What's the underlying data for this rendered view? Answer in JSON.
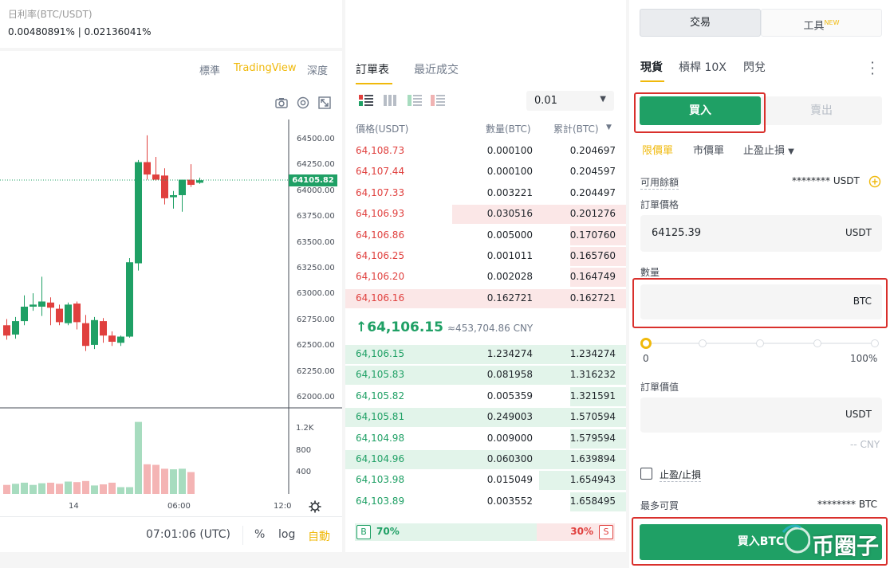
{
  "header": {
    "rate_label": "日利率(BTC/USDT)",
    "rate_value": "0.00480891% | 0.02136041%"
  },
  "chart": {
    "tabs": [
      {
        "label": "標準"
      },
      {
        "label": "TradingView"
      },
      {
        "label": "深度"
      }
    ],
    "active_tab": "TradingView",
    "price_ticks": [
      "64500.00",
      "64250.00",
      "64000.00",
      "63750.00",
      "63500.00",
      "63250.00",
      "63000.00",
      "62750.00",
      "62500.00",
      "62250.00",
      "62000.00"
    ],
    "current_price_tag": "64105.82",
    "volume_ticks": [
      "1.2K",
      "800",
      "400"
    ],
    "time_ticks": [
      "14",
      "06:00",
      "12:0"
    ],
    "clock": "07:01:06 (UTC)",
    "pct": "%",
    "log": "log",
    "auto": "自動"
  },
  "chart_data": {
    "type": "candlestick",
    "ylim": [
      62000,
      64600
    ],
    "candles": [
      {
        "o": 62700,
        "h": 62760,
        "l": 62560,
        "c": 62600
      },
      {
        "o": 62610,
        "h": 62780,
        "l": 62570,
        "c": 62740
      },
      {
        "o": 62740,
        "h": 62990,
        "l": 62700,
        "c": 62880
      },
      {
        "o": 62880,
        "h": 63010,
        "l": 62840,
        "c": 62900
      },
      {
        "o": 62880,
        "h": 63170,
        "l": 62790,
        "c": 62930
      },
      {
        "o": 62920,
        "h": 62970,
        "l": 62700,
        "c": 62870
      },
      {
        "o": 62860,
        "h": 62900,
        "l": 62700,
        "c": 62730
      },
      {
        "o": 62720,
        "h": 62920,
        "l": 62700,
        "c": 62900
      },
      {
        "o": 62910,
        "h": 62930,
        "l": 62660,
        "c": 62730
      },
      {
        "o": 62720,
        "h": 62800,
        "l": 62450,
        "c": 62500
      },
      {
        "o": 62510,
        "h": 62780,
        "l": 62470,
        "c": 62750
      },
      {
        "o": 62740,
        "h": 62770,
        "l": 62530,
        "c": 62600
      },
      {
        "o": 62600,
        "h": 62640,
        "l": 62500,
        "c": 62540
      },
      {
        "o": 62530,
        "h": 62600,
        "l": 62500,
        "c": 62590
      },
      {
        "o": 62590,
        "h": 63350,
        "l": 62580,
        "c": 63310
      },
      {
        "o": 63300,
        "h": 64300,
        "l": 63230,
        "c": 64280
      },
      {
        "o": 64280,
        "h": 64540,
        "l": 64110,
        "c": 64160
      },
      {
        "o": 64160,
        "h": 64330,
        "l": 64100,
        "c": 64110
      },
      {
        "o": 64150,
        "h": 64220,
        "l": 63870,
        "c": 63930
      },
      {
        "o": 63940,
        "h": 64000,
        "l": 63830,
        "c": 63960
      },
      {
        "o": 63960,
        "h": 64080,
        "l": 63800,
        "c": 64110
      },
      {
        "o": 64110,
        "h": 64260,
        "l": 64040,
        "c": 64060
      },
      {
        "o": 64080,
        "h": 64130,
        "l": 64070,
        "c": 64105
      }
    ],
    "volumes": [
      190,
      210,
      230,
      190,
      220,
      230,
      210,
      250,
      240,
      260,
      180,
      200,
      230,
      150,
      150,
      1320,
      560,
      550,
      480,
      470,
      480,
      420,
      0
    ]
  },
  "orderbook": {
    "tabs": [
      {
        "label": "訂單表"
      },
      {
        "label": "最近成交"
      }
    ],
    "precision": "0.01",
    "headers": {
      "price": "價格(USDT)",
      "qty": "數量(BTC)",
      "total": "累計(BTC)"
    },
    "asks": [
      {
        "price": "64,108.73",
        "qty": "0.000100",
        "total": "0.204697",
        "depth": 0
      },
      {
        "price": "64,107.44",
        "qty": "0.000100",
        "total": "0.204597",
        "depth": 0
      },
      {
        "price": "64,107.33",
        "qty": "0.003221",
        "total": "0.204497",
        "depth": 0
      },
      {
        "price": "64,106.93",
        "qty": "0.030516",
        "total": "0.201276",
        "depth": 0.62
      },
      {
        "price": "64,106.86",
        "qty": "0.005000",
        "total": "0.170760",
        "depth": 0.2
      },
      {
        "price": "64,106.25",
        "qty": "0.001011",
        "total": "0.165760",
        "depth": 0.2
      },
      {
        "price": "64,106.20",
        "qty": "0.002028",
        "total": "0.164749",
        "depth": 0.2
      },
      {
        "price": "64,106.16",
        "qty": "0.162721",
        "total": "0.162721",
        "depth": 1
      }
    ],
    "last_price": "64,106.15",
    "last_price_cny": "≈453,704.86 CNY",
    "bids": [
      {
        "price": "64,106.15",
        "qty": "1.234274",
        "total": "1.234274",
        "depth": 1
      },
      {
        "price": "64,105.83",
        "qty": "0.081958",
        "total": "1.316232",
        "depth": 1
      },
      {
        "price": "64,105.82",
        "qty": "0.005359",
        "total": "1.321591",
        "depth": 0.2
      },
      {
        "price": "64,105.81",
        "qty": "0.249003",
        "total": "1.570594",
        "depth": 1
      },
      {
        "price": "64,104.98",
        "qty": "0.009000",
        "total": "1.579594",
        "depth": 0.2
      },
      {
        "price": "64,104.96",
        "qty": "0.060300",
        "total": "1.639894",
        "depth": 1
      },
      {
        "price": "64,103.98",
        "qty": "0.015049",
        "total": "1.654943",
        "depth": 0.31
      },
      {
        "price": "64,103.89",
        "qty": "0.003552",
        "total": "1.658495",
        "depth": 0.2
      }
    ],
    "ratio": {
      "buy_label": "B",
      "buy_pct": "70%",
      "sell_pct": "30%",
      "sell_label": "S",
      "buy_fraction": 0.7
    }
  },
  "trade": {
    "top_tabs": [
      {
        "label": "交易"
      },
      {
        "label": "工具"
      }
    ],
    "new_badge": "NEW",
    "market_tabs": [
      {
        "label": "現貨"
      },
      {
        "label": "槓桿 10X"
      },
      {
        "label": "閃兌"
      }
    ],
    "buy_label": "買入",
    "sell_label": "賣出",
    "order_types": [
      {
        "label": "限價單"
      },
      {
        "label": "市價單"
      },
      {
        "label": "止盈止損"
      }
    ],
    "available_label": "可用餘額",
    "available_value": "******** USDT",
    "price_label": "訂單價格",
    "price_value": "64125.39",
    "price_unit": "USDT",
    "qty_label": "數量",
    "qty_unit": "BTC",
    "slider_min": "0",
    "slider_max": "100%",
    "slider_fraction": 0,
    "total_label": "訂單價值",
    "total_unit": "USDT",
    "total_cny": "-- CNY",
    "tpsl_label": "止盈/止損",
    "max_buy_label": "最多可買",
    "max_buy_value": "******** BTC",
    "submit_label": "買入BTC",
    "watermark": "币圈子"
  },
  "colors": {
    "up": "#1fa065",
    "down": "#e0403e",
    "accent": "#f0b90b",
    "buy": "#1fa065"
  }
}
